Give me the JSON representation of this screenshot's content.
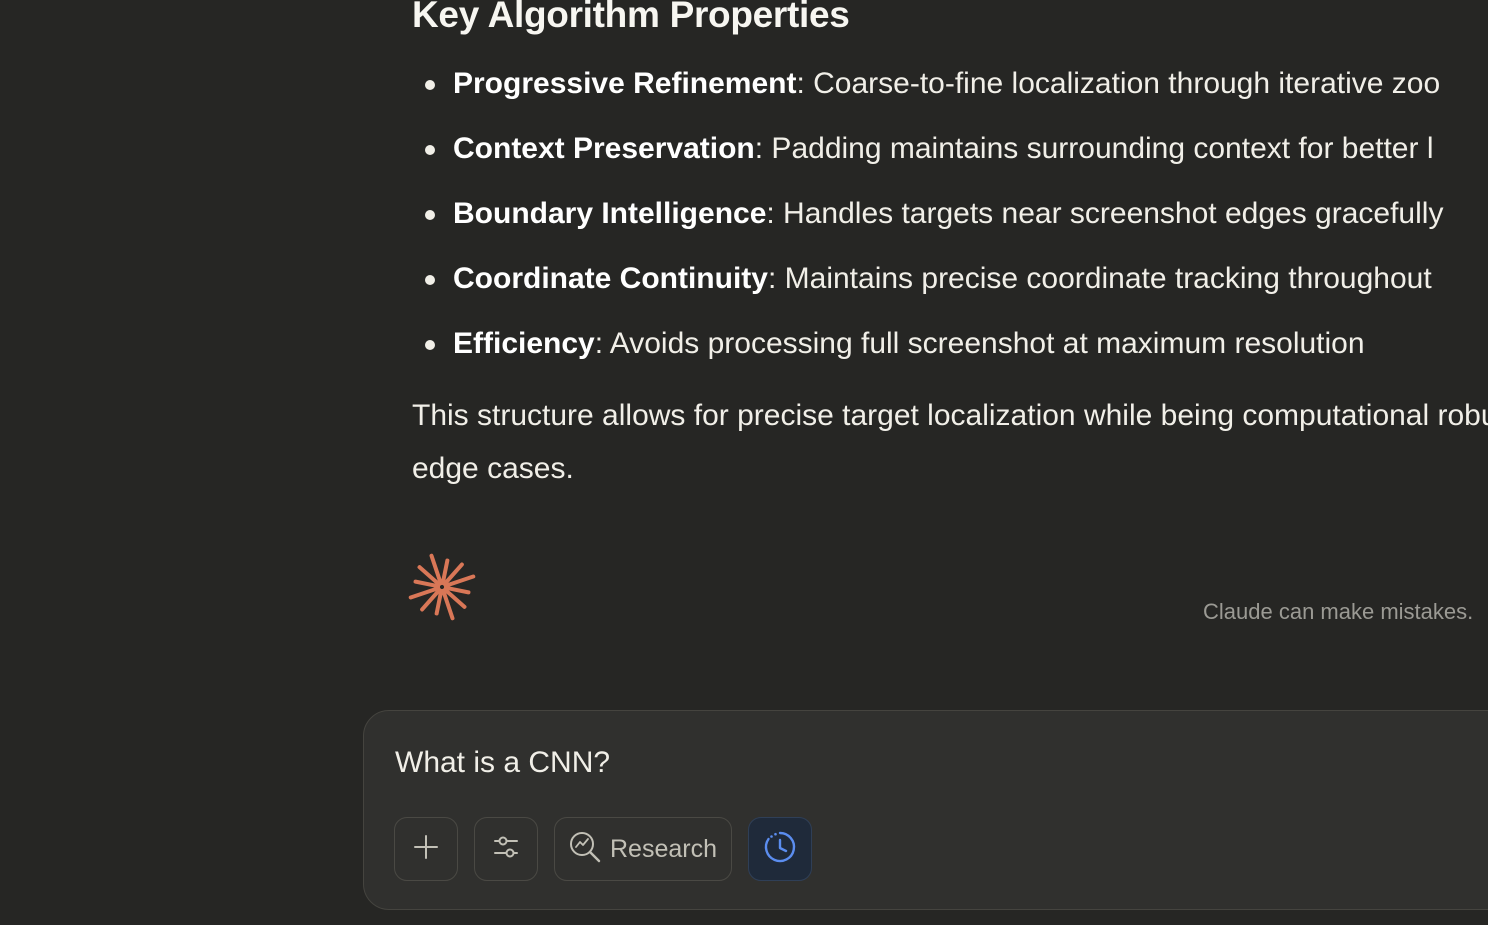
{
  "content": {
    "heading": "Key Algorithm Properties",
    "bullets": [
      {
        "term": "Progressive Refinement",
        "text": ": Coarse-to-fine localization through iterative zoo"
      },
      {
        "term": "Context Preservation",
        "text": ": Padding maintains surrounding context for better l"
      },
      {
        "term": "Boundary Intelligence",
        "text": ": Handles targets near screenshot edges gracefully"
      },
      {
        "term": "Coordinate Continuity",
        "text": ": Maintains precise coordinate tracking throughout"
      },
      {
        "term": "Efficiency",
        "text": ": Avoids processing full screenshot at maximum resolution"
      }
    ],
    "paragraph": "This structure allows for precise target localization while being computational robust to edge cases."
  },
  "disclaimer": "Claude can make mistakes.",
  "composer": {
    "input_text": "What is a CNN?",
    "buttons": {
      "add_icon": "plus-icon",
      "tools_icon": "sliders-icon",
      "research_label": "Research",
      "research_icon": "research-icon",
      "history_icon": "clock-icon"
    }
  },
  "colors": {
    "background": "#262624",
    "composer_background": "#30302e",
    "accent_logo": "#d97757",
    "history_active": "#5b8def",
    "muted_text": "#9b9a94"
  }
}
